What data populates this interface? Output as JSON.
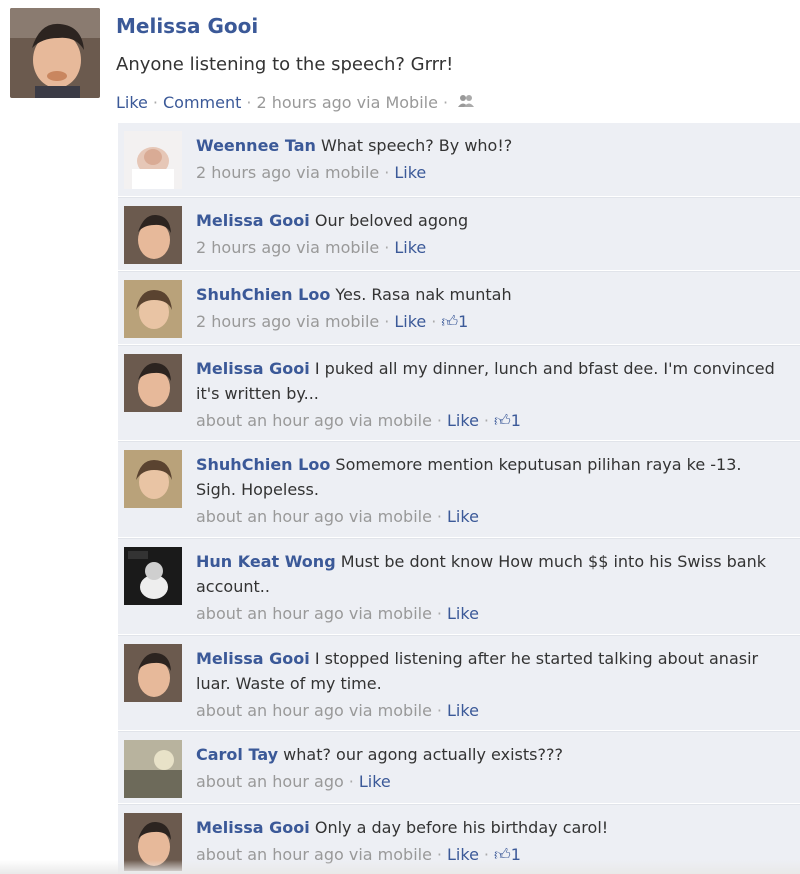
{
  "post": {
    "author": "Melissa Gooi",
    "text": "Anyone listening to the speech? Grrr!",
    "like_label": "Like",
    "comment_label": "Comment",
    "timestamp": "2 hours ago via Mobile"
  },
  "comments": [
    {
      "author": "Weennee Tan",
      "text": "What speech? By who!?",
      "meta": "2 hours ago via mobile",
      "like": "Like",
      "likes_count": ""
    },
    {
      "author": "Melissa Gooi",
      "text": "Our beloved agong",
      "meta": "2 hours ago via mobile",
      "like": "Like",
      "likes_count": ""
    },
    {
      "author": "ShuhChien Loo",
      "text": "Yes. Rasa nak muntah",
      "meta": "2 hours ago via mobile",
      "like": "Like",
      "likes_count": "1"
    },
    {
      "author": "Melissa Gooi",
      "text": "I puked all my dinner, lunch and bfast dee. I'm convinced it's written by...",
      "meta": "about an hour ago via mobile",
      "like": "Like",
      "likes_count": "1"
    },
    {
      "author": "ShuhChien Loo",
      "text": "Somemore mention keputusan pilihan raya ke -13. Sigh. Hopeless.",
      "meta": "about an hour ago via mobile",
      "like": "Like",
      "likes_count": ""
    },
    {
      "author": "Hun Keat Wong",
      "text": "Must be dont know How much $$ into his Swiss bank account..",
      "meta": "about an hour ago via mobile",
      "like": "Like",
      "likes_count": ""
    },
    {
      "author": "Melissa Gooi",
      "text": "I stopped listening after he started talking about anasir luar. Waste of my time.",
      "meta": "about an hour ago via mobile",
      "like": "Like",
      "likes_count": ""
    },
    {
      "author": "Carol Tay",
      "text": "what? our agong actually exists???",
      "meta": "about an hour ago",
      "like": "Like",
      "likes_count": ""
    },
    {
      "author": "Melissa Gooi",
      "text": "Only a day before his birthday carol!",
      "meta": "about an hour ago via mobile",
      "like": "Like",
      "likes_count": "1"
    }
  ],
  "colors": {
    "link": "#3b5998",
    "meta": "#999999",
    "comment_bg": "#edeff4"
  },
  "icons": {
    "audience": "friends-icon",
    "like": "thumbs-up-icon"
  }
}
